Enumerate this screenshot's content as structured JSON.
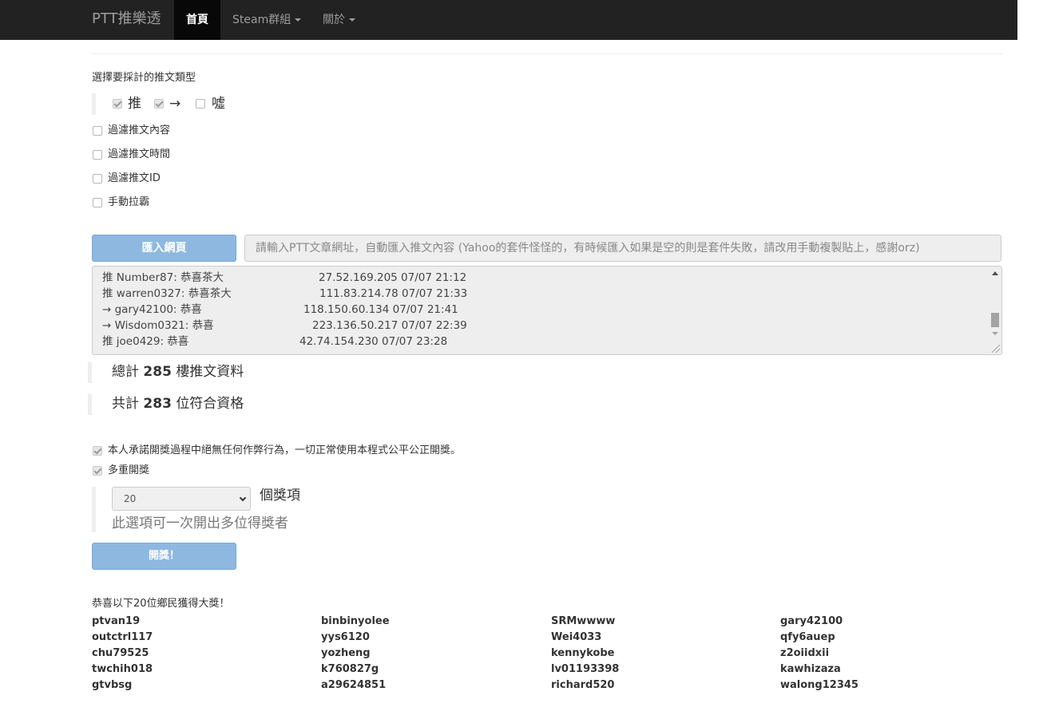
{
  "navbar": {
    "brand": "PTT推樂透",
    "items": [
      {
        "label": "首頁",
        "active": true
      },
      {
        "label": "Steam群組",
        "dropdown": true
      },
      {
        "label": "關於",
        "dropdown": true
      }
    ]
  },
  "push_type": {
    "heading": "選擇要採計的推文類型",
    "options": [
      {
        "label": "推",
        "checked": true
      },
      {
        "label": "→",
        "checked": true
      },
      {
        "label": "噓",
        "checked": false
      }
    ]
  },
  "filters": [
    {
      "label": "過濾推文內容",
      "checked": false
    },
    {
      "label": "過濾推文時間",
      "checked": false
    },
    {
      "label": "過濾推文ID",
      "checked": false
    },
    {
      "label": "手動拉霸",
      "checked": false
    }
  ],
  "import": {
    "button_label": "匯入網頁",
    "url_placeholder": "請輸入PTT文章網址，自動匯入推文內容 (Yahoo的套件怪怪的，有時候匯入如果是空的則是套件失敗，請改用手動複製貼上，感謝orz)"
  },
  "comments": [
    {
      "text": "推 Number87: 恭喜茶大",
      "meta": "27.52.169.205 07/07 21:12"
    },
    {
      "text": "推 warren0327: 恭喜茶大",
      "meta": "111.83.214.78 07/07 21:33"
    },
    {
      "text": "→ gary42100: 恭喜",
      "meta": "118.150.60.134 07/07 21:41"
    },
    {
      "text": "→ Wisdom0321: 恭喜",
      "meta": "223.136.50.217 07/07 22:39"
    },
    {
      "text": "推 joe0429: 恭喜",
      "meta": "42.74.154.230 07/07 23:28"
    }
  ],
  "stats": {
    "total_prefix": "總計",
    "total_count": "285",
    "total_suffix": "樓推文資料",
    "qualified_prefix": "共計",
    "qualified_count": "283",
    "qualified_suffix": "位符合資格"
  },
  "draw": {
    "pledge_label": "本人承諾開獎過程中絕無任何作弊行為，一切正常使用本程式公平公正開獎。",
    "pledge_checked": true,
    "multi_label": "多重開獎",
    "multi_checked": true,
    "prize_count": "20",
    "prize_unit": "個獎項",
    "multi_hint": "此選項可一次開出多位得獎者",
    "draw_button": "開獎！"
  },
  "winners": {
    "title": "恭喜以下20位鄉民獲得大獎！",
    "names": [
      "ptvan19",
      "binbinyolee",
      "SRMwwww",
      "gary42100",
      "outctrl117",
      "yys6120",
      "Wei4033",
      "qfy6auep",
      "chu79525",
      "yozheng",
      "kennykobe",
      "z2oiidxii",
      "twchih018",
      "k760827g",
      "lv01193398",
      "kawhizaza",
      "gtvbsg",
      "a29624851",
      "richard520",
      "walong12345"
    ]
  }
}
